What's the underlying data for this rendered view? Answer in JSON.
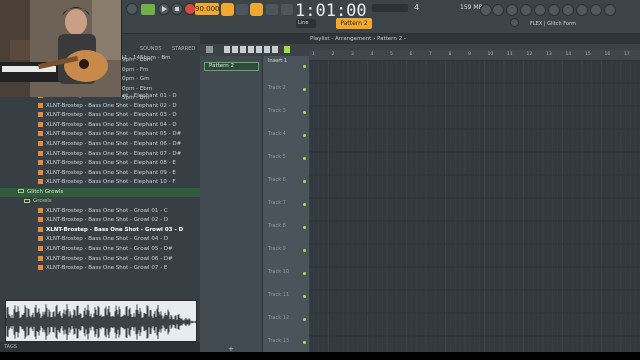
{
  "toolbar": {
    "tempo": "90.000",
    "time": "1:01:00",
    "pattern": "Pattern 2",
    "snap": "Line",
    "hint": "FLEX | Glitch Form",
    "cpu": "159 MB",
    "beats": "4"
  },
  "browser": {
    "tabs": [
      "SOUNDS",
      "STARRED"
    ],
    "items": [
      {
        "label": "XLNT-Brostep - Vocal Chop 11 - 145bpm - Bm",
        "kind": "file"
      },
      {
        "label": "One Shots",
        "kind": "folder"
      },
      {
        "label": "Bass Shots",
        "kind": "folder"
      },
      {
        "label": "Elephants",
        "kind": "folder"
      },
      {
        "label": "XLNT-Brostep - Bass One Shot - Elephant 01 - D",
        "kind": "file"
      },
      {
        "label": "XLNT-Brostep - Bass One Shot - Elephant 02 - D",
        "kind": "file"
      },
      {
        "label": "XLNT-Brostep - Bass One Shot - Elephant 03 - D",
        "kind": "file"
      },
      {
        "label": "XLNT-Brostep - Bass One Shot - Elephant 04 - D",
        "kind": "file"
      },
      {
        "label": "XLNT-Brostep - Bass One Shot - Elephant 05 - D#",
        "kind": "file"
      },
      {
        "label": "XLNT-Brostep - Bass One Shot - Elephant 06 - D#",
        "kind": "file"
      },
      {
        "label": "XLNT-Brostep - Bass One Shot - Elephant 07 - D#",
        "kind": "file"
      },
      {
        "label": "XLNT-Brostep - Bass One Shot - Elephant 08 - E",
        "kind": "file"
      },
      {
        "label": "XLNT-Brostep - Bass One Shot - Elephant 09 - E",
        "kind": "file"
      },
      {
        "label": "XLNT-Brostep - Bass One Shot - Elephant 10 - F",
        "kind": "file"
      },
      {
        "label": "Glitch Growls",
        "kind": "folder-sel"
      },
      {
        "label": "Growls",
        "kind": "folder"
      },
      {
        "label": "XLNT-Brostep - Bass One Shot - Growl 01 - C",
        "kind": "file"
      },
      {
        "label": "XLNT-Brostep - Bass One Shot - Growl 02 - D",
        "kind": "file"
      },
      {
        "label": "XLNT-Brostep - Bass One Shot - Growl 03 - D",
        "kind": "file-hl"
      },
      {
        "label": "XLNT-Brostep - Bass One Shot - Growl 04 - D",
        "kind": "file"
      },
      {
        "label": "XLNT-Brostep - Bass One Shot - Growl 05 - D#",
        "kind": "file"
      },
      {
        "label": "XLNT-Brostep - Bass One Shot - Growl 06 - D#",
        "kind": "file"
      },
      {
        "label": "XLNT-Brostep - Bass One Shot - Growl 07 - E",
        "kind": "file"
      }
    ],
    "partial_items": [
      "9pm - Ebm",
      "0pm - Fm",
      "0pm - Gm",
      "0pm - Ebm",
      "5pm - Bm"
    ],
    "tags_label": "TAGS"
  },
  "playlist": {
    "title": "Playlist - Arrangement › Pattern 2 –",
    "pattern_item": "Pattern 2",
    "first_track": "Insert 1",
    "tracks": [
      "Track 2",
      "Track 3",
      "Track 4",
      "Track 5",
      "Track 6",
      "Track 7",
      "Track 8",
      "Track 9",
      "Track 10",
      "Track 11",
      "Track 12",
      "Track 13",
      "Track 14"
    ],
    "ruler": [
      "1",
      "2",
      "3",
      "4",
      "5",
      "6",
      "7",
      "8",
      "9",
      "10",
      "11",
      "12",
      "13",
      "14",
      "15",
      "16",
      "17"
    ]
  },
  "colors": {
    "accent": "#f0a830",
    "grid": "#323a3f",
    "folder": "#9ad080",
    "selected": "#2f5a3c"
  }
}
